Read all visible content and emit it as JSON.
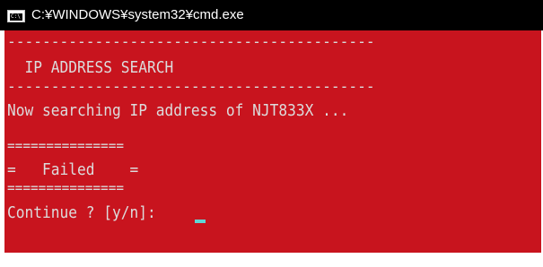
{
  "window": {
    "title": "C:¥WINDOWS¥system32¥cmd.exe",
    "icon": "console-app-icon",
    "icon_prompt": "C:\\"
  },
  "console": {
    "background": "#c8141e",
    "text_color": "#dcdcdc",
    "cursor_color": "#5fd6d6",
    "lines": {
      "dashes_top": "------------------------------------------",
      "header": "  IP ADDRESS SEARCH",
      "dashes_bottom": "------------------------------------------",
      "searching": "Now searching IP address of NJT833X ...",
      "eq_top": "===============",
      "failed": "=   Failed    =",
      "eq_bottom": "===============",
      "prompt": "Continue ? [y/n]: "
    }
  }
}
